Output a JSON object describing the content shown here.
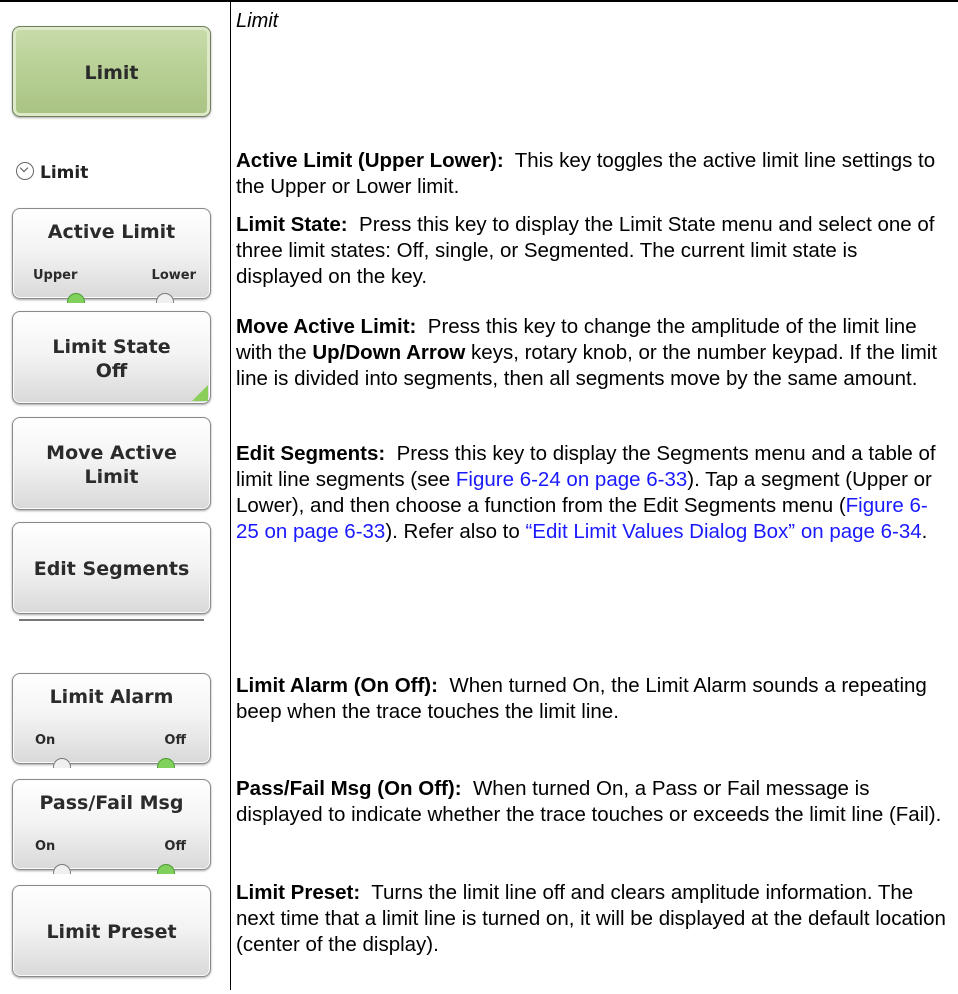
{
  "caption": "Limit",
  "keys": {
    "limit": "Limit",
    "section": "Limit",
    "active_limit": {
      "label": "Active Limit",
      "opt1": "Upper",
      "opt2": "Lower"
    },
    "limit_state": {
      "line1": "Limit State",
      "line2": "Off"
    },
    "move_active": {
      "line1": "Move Active",
      "line2": "Limit"
    },
    "edit_segments": "Edit Segments",
    "limit_alarm": {
      "label": "Limit Alarm",
      "opt1": "On",
      "opt2": "Off"
    },
    "pass_fail": {
      "label": "Pass/Fail Msg",
      "opt1": "On",
      "opt2": "Off"
    },
    "limit_preset": "Limit Preset"
  },
  "descriptions": {
    "active_limit": {
      "term": "Active Limit (Upper  Lower):",
      "text": "This key toggles the active limit line settings to the Upper or Lower limit."
    },
    "limit_state": {
      "term": "Limit State:",
      "text": "Press this key to display the Limit State menu and select one of three limit states:  Off, single, or Segmented. The current limit state is displayed on the key."
    },
    "move_active": {
      "term": "Move Active Limit:",
      "text1": "Press this key to change the amplitude of the limit line with the",
      "bold": "Up/Down Arrow",
      "text2": "keys, rotary knob, or the number keypad. If the limit line is divided into segments, then all segments move by the same amount."
    },
    "edit_segments": {
      "term": "Edit Segments:",
      "text1": "Press this key to display the Segments menu and a table of limit line segments (see",
      "link1": "Figure 6-24 on page 6-33",
      "text2": "). Tap a segment (Upper or Lower), and then choose a function from the Edit Segments menu (",
      "link2": "Figure 6-25 on page 6-33",
      "text3": "). Refer also to",
      "link3": "“Edit Limit Values Dialog Box” on page 6-34",
      "text4": "."
    },
    "limit_alarm": {
      "term": "Limit Alarm (On  Off):",
      "text": "When turned On, the Limit Alarm sounds a repeating beep when the trace touches the limit line."
    },
    "pass_fail": {
      "term": "Pass/Fail Msg (On  Off):",
      "text": "When turned On, a Pass or Fail message is displayed to indicate whether the trace touches or exceeds the limit line (Fail)."
    },
    "limit_preset": {
      "term": "Limit Preset:",
      "text": "Turns the limit line off and clears amplitude information. The next time that a limit line is turned on, it will be displayed at the default location (center of the display)."
    }
  },
  "colors": {
    "link": "#1a1aff",
    "key_green": "#b7cf94",
    "indicator_on": "#7fd15b"
  }
}
